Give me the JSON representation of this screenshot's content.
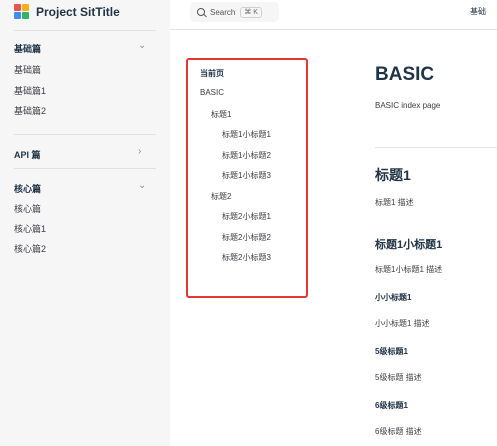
{
  "brand": {
    "title": "Project SitTitle"
  },
  "sidebar": {
    "groups": [
      {
        "title": "基础篇",
        "chevron": "chevron-down",
        "items": [
          "基础篇",
          "基础篇1",
          "基础篇2"
        ]
      },
      {
        "title": "API 篇",
        "chevron": "chevron-right",
        "items": []
      },
      {
        "title": "核心篇",
        "chevron": "chevron-down",
        "items": [
          "核心篇",
          "核心篇1",
          "核心篇2"
        ]
      }
    ]
  },
  "search": {
    "label": "Search",
    "shortcut": "⌘ K"
  },
  "nav": {
    "link": "基础"
  },
  "outline": {
    "title": "当前页",
    "items": [
      "BASIC",
      "标题1",
      "标题1小标题1",
      "标题1小标题2",
      "标题1小标题3",
      "标题2",
      "标题2小标题1",
      "标题2小标题2",
      "标题2小标题3"
    ]
  },
  "content": {
    "h1": "BASIC",
    "intro": "BASIC index page",
    "h2": "标题1",
    "h2_desc": "标题1 描述",
    "h3": "标题1小标题1",
    "h3_desc": "标题1小标题1 描述",
    "h4a": "小小标题1",
    "h4a_desc": "小小标题1 描述",
    "h5": "5级标题1",
    "h5_desc": "5级标题 描述",
    "h6": "6级标题1",
    "h6_desc": "6级标题 描述"
  },
  "colors": {
    "highlight_border": "#e53535",
    "sidebar_bg": "#f6f6f7"
  }
}
